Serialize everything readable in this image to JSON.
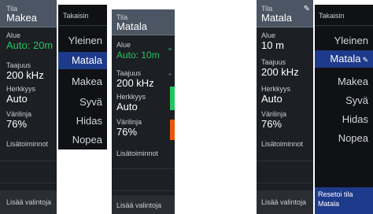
{
  "panel1": {
    "tila": {
      "label": "Tila",
      "value": "Makea"
    },
    "alue": {
      "label": "Alue",
      "value": "Auto: 20m"
    },
    "taajuus": {
      "label": "Taajuus",
      "value": "200 kHz"
    },
    "herkkyys": {
      "label": "Herkkyys",
      "value": "Auto"
    },
    "varilinja": {
      "label": "Värilinja",
      "value": "76%"
    },
    "lisatoiminnot": "Lisätoiminnot",
    "lisaa_valintoja": "Lisää valintoja"
  },
  "menu1": {
    "back": "Takaisin",
    "items": [
      "Yleinen",
      "Matala",
      "Makea",
      "Syvä",
      "Hidas",
      "Nopea"
    ],
    "active_index": 1
  },
  "panel2": {
    "tila": {
      "label": "Tila",
      "value": "Matala"
    },
    "alue": {
      "label": "Alue",
      "value": "Auto: 10m"
    },
    "taajuus": {
      "label": "Taajuus",
      "value": "200 kHz"
    },
    "herkkyys": {
      "label": "Herkkyys",
      "value": "Auto"
    },
    "varilinja": {
      "label": "Värilinja",
      "value": "76%"
    },
    "lisatoiminnot": "Lisätoiminnot",
    "lisaa_valintoja": "Lisää valintoja"
  },
  "panel3": {
    "tila": {
      "label": "Tila",
      "value": "Matala"
    },
    "alue": {
      "label": "Alue",
      "value": "10 m"
    },
    "taajuus": {
      "label": "Taajuus",
      "value": "200 kHz"
    },
    "herkkyys": {
      "label": "Herkkyys",
      "value": "Auto"
    },
    "varilinja": {
      "label": "Värilinja",
      "value": "76%"
    },
    "lisatoiminnot": "Lisätoiminnot",
    "lisaa_valintoja": "Lisää valintoja"
  },
  "menu2": {
    "back": "Takaisin",
    "items": [
      "Yleinen",
      "Matala",
      "Makea",
      "Syvä",
      "Hidas",
      "Nopea"
    ],
    "active_index": 1,
    "reset_label": "Resetoi tila",
    "reset_value": "Matala"
  },
  "colors": {
    "panel_bg": "#1c1f24",
    "header_bg": "#4b5563",
    "menu_bg": "#0f1114",
    "active_bg": "#1e3a8a",
    "green": "#22c55e",
    "red": "#dc2626"
  }
}
